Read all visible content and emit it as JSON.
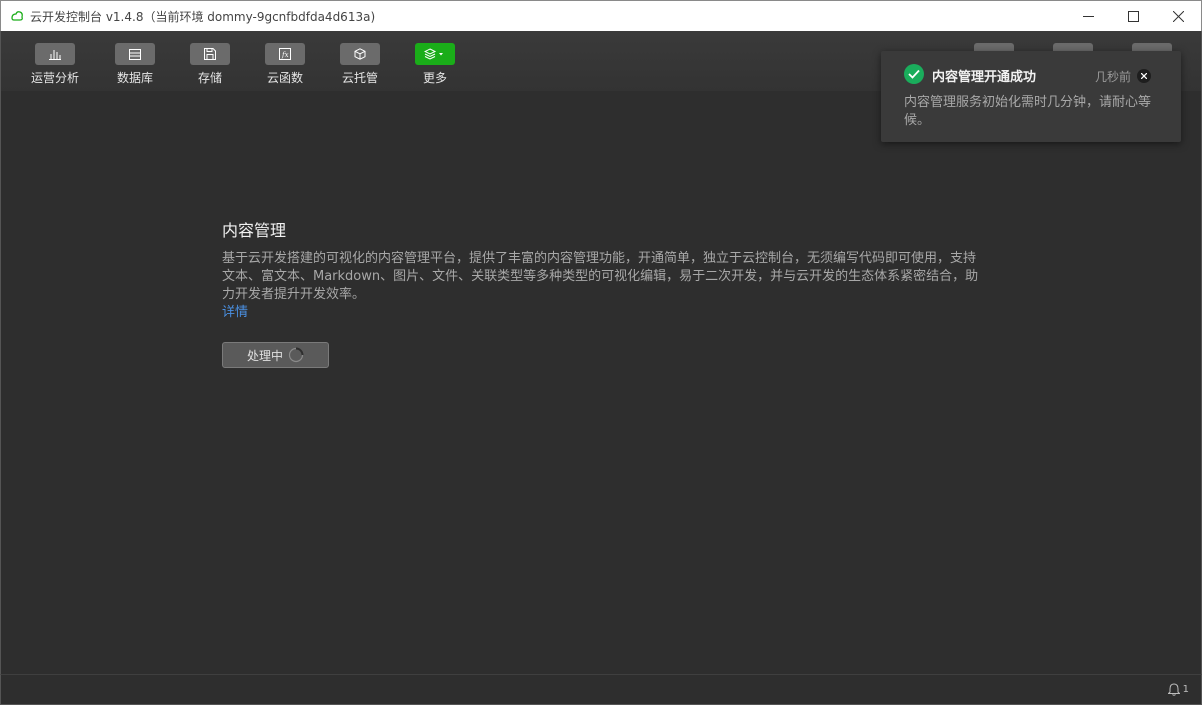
{
  "window": {
    "title": "云开发控制台 v1.4.8（当前环境 dommy-9gcnfbdfda4d613a)"
  },
  "toolbar": {
    "items": [
      {
        "label": "运营分析",
        "icon": "bar-chart-icon"
      },
      {
        "label": "数据库",
        "icon": "database-icon"
      },
      {
        "label": "存储",
        "icon": "storage-icon"
      },
      {
        "label": "云函数",
        "icon": "function-icon"
      },
      {
        "label": "云托管",
        "icon": "cube-icon"
      },
      {
        "label": "更多",
        "icon": "layers-icon"
      }
    ]
  },
  "content": {
    "title": "内容管理",
    "description": "基于云开发搭建的可视化的内容管理平台，提供了丰富的内容管理功能，开通简单，独立于云控制台，无须编写代码即可使用，支持文本、富文本、Markdown、图片、文件、关联类型等多种类型的可视化编辑，易于二次开发，并与云开发的生态体系紧密结合，助力开发者提升开发效率。",
    "link": "详情",
    "button": "处理中"
  },
  "toast": {
    "title": "内容管理开通成功",
    "time": "几秒前",
    "body": "内容管理服务初始化需时几分钟，请耐心等候。"
  },
  "statusbar": {
    "notification_count": "1"
  },
  "colors": {
    "accent_green": "#1aad19",
    "link_blue": "#4a90e2",
    "background": "#2e2e2e"
  }
}
